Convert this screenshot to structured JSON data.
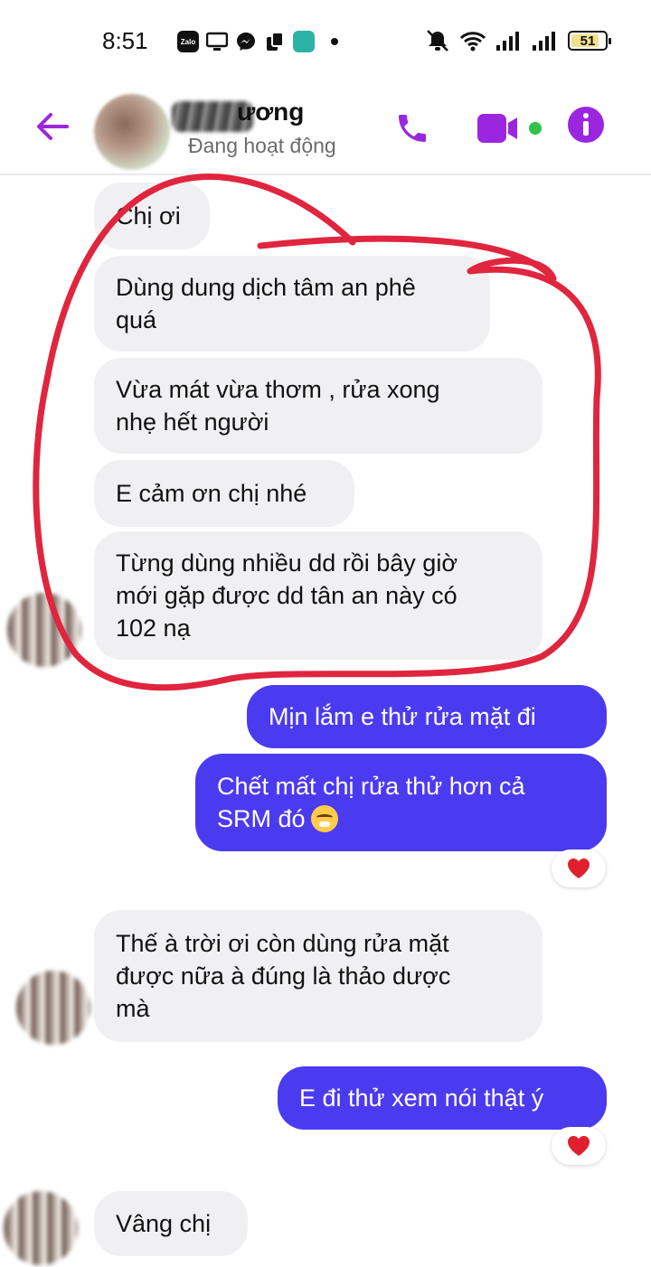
{
  "status_bar": {
    "time": "8:51",
    "zalo_label": "Zalo",
    "battery": "51",
    "icons": [
      "zalo-icon",
      "screen-icon",
      "messenger-icon",
      "copy-icon",
      "app-icon",
      "dot-icon",
      "mute-icon",
      "wifi-icon",
      "signal-icon",
      "signal-icon",
      "battery-icon"
    ]
  },
  "header": {
    "contact_name": "ương",
    "contact_status": "Đang hoạt động",
    "accent_color": "#9b26e0",
    "icons": [
      "back-arrow-icon",
      "phone-icon",
      "video-camera-icon",
      "info-icon"
    ]
  },
  "messages": [
    {
      "direction": "in",
      "text": "Chị ơi"
    },
    {
      "direction": "in",
      "lines": [
        "Dùng dung dịch tâm an phê",
        "quá"
      ]
    },
    {
      "direction": "in",
      "lines": [
        "Vừa mát vừa thơm , rửa xong",
        "nhẹ hết người"
      ]
    },
    {
      "direction": "in",
      "text": "E cảm ơn chị nhé"
    },
    {
      "direction": "in",
      "lines": [
        "Từng dùng nhiều dd rồi bây giờ",
        "mới gặp được dd tân an này có",
        "102 nạ"
      ]
    },
    {
      "direction": "out",
      "text": "Mịn lắm e thử rửa mặt đi"
    },
    {
      "direction": "out",
      "lines": [
        "Chết mất chị rửa thử hơn cả",
        "SRM đó"
      ],
      "emoji": "weary-face-emoji",
      "reaction": "heart"
    },
    {
      "direction": "in",
      "lines": [
        "Thế à trời ơi còn dùng rửa mặt",
        "được nữa à đúng là thảo dược",
        "mà"
      ]
    },
    {
      "direction": "out",
      "text": "E đi thử xem nói thật ý",
      "reaction": "heart"
    },
    {
      "direction": "in",
      "text": "Vâng chị"
    }
  ],
  "colors": {
    "outgoing_bubble": "#4b3bf0",
    "incoming_bubble": "#f0f0f2",
    "reaction_heart": "#e0202e",
    "annotation_circle": "#e0253f"
  }
}
